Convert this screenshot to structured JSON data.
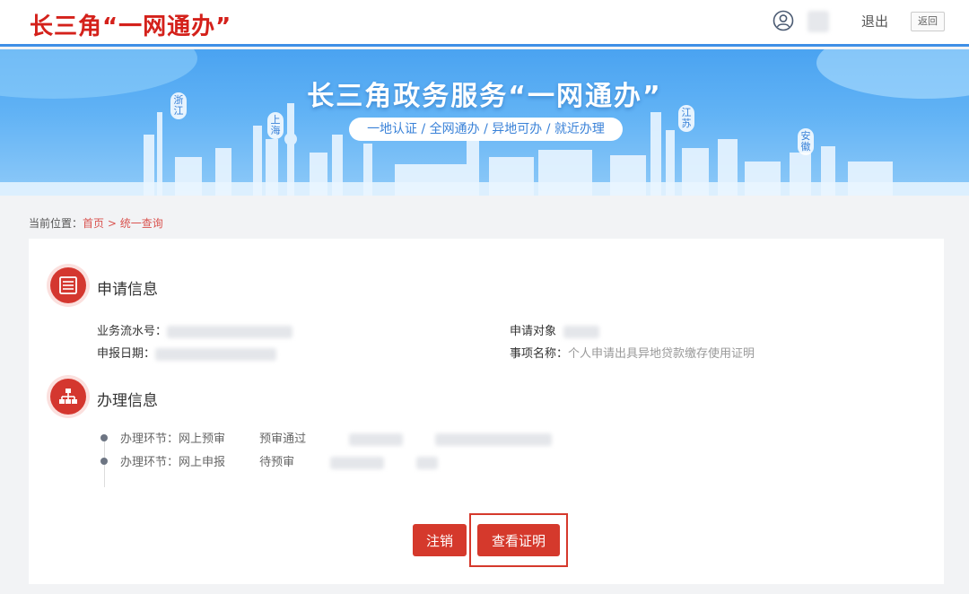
{
  "header": {
    "logo_text": "长三角“一网通办”",
    "logout_label": "退出",
    "back_label": "返回"
  },
  "banner": {
    "title": "长三角政务服务“一网通办”",
    "slogan": "一地认证 / 全网通办 / 异地可办 / 就近办理",
    "cities": [
      "浙江",
      "上海",
      "江苏",
      "安徽"
    ]
  },
  "breadcrumb": {
    "prefix": "当前位置：",
    "home": "首页",
    "separator": " > ",
    "current": "统一查询"
  },
  "application_info": {
    "title": "申请信息",
    "serial_label": "业务流水号：",
    "date_label": "申报日期：",
    "applicant_label": "申请对象",
    "item_label": "事项名称：",
    "item_value": "个人申请出具异地贷款缴存使用证明"
  },
  "process_info": {
    "title": "办理信息",
    "steps": [
      {
        "stage": "办理环节：网上预审",
        "status": "预审通过"
      },
      {
        "stage": "办理环节：网上申报",
        "status": "待预审"
      }
    ]
  },
  "actions": {
    "cancel_label": "注销",
    "view_cert_label": "查看证明"
  },
  "colors": {
    "brand_red": "#d4211b",
    "button_red": "#d5392c",
    "banner_blue": "#4aa3f1"
  }
}
